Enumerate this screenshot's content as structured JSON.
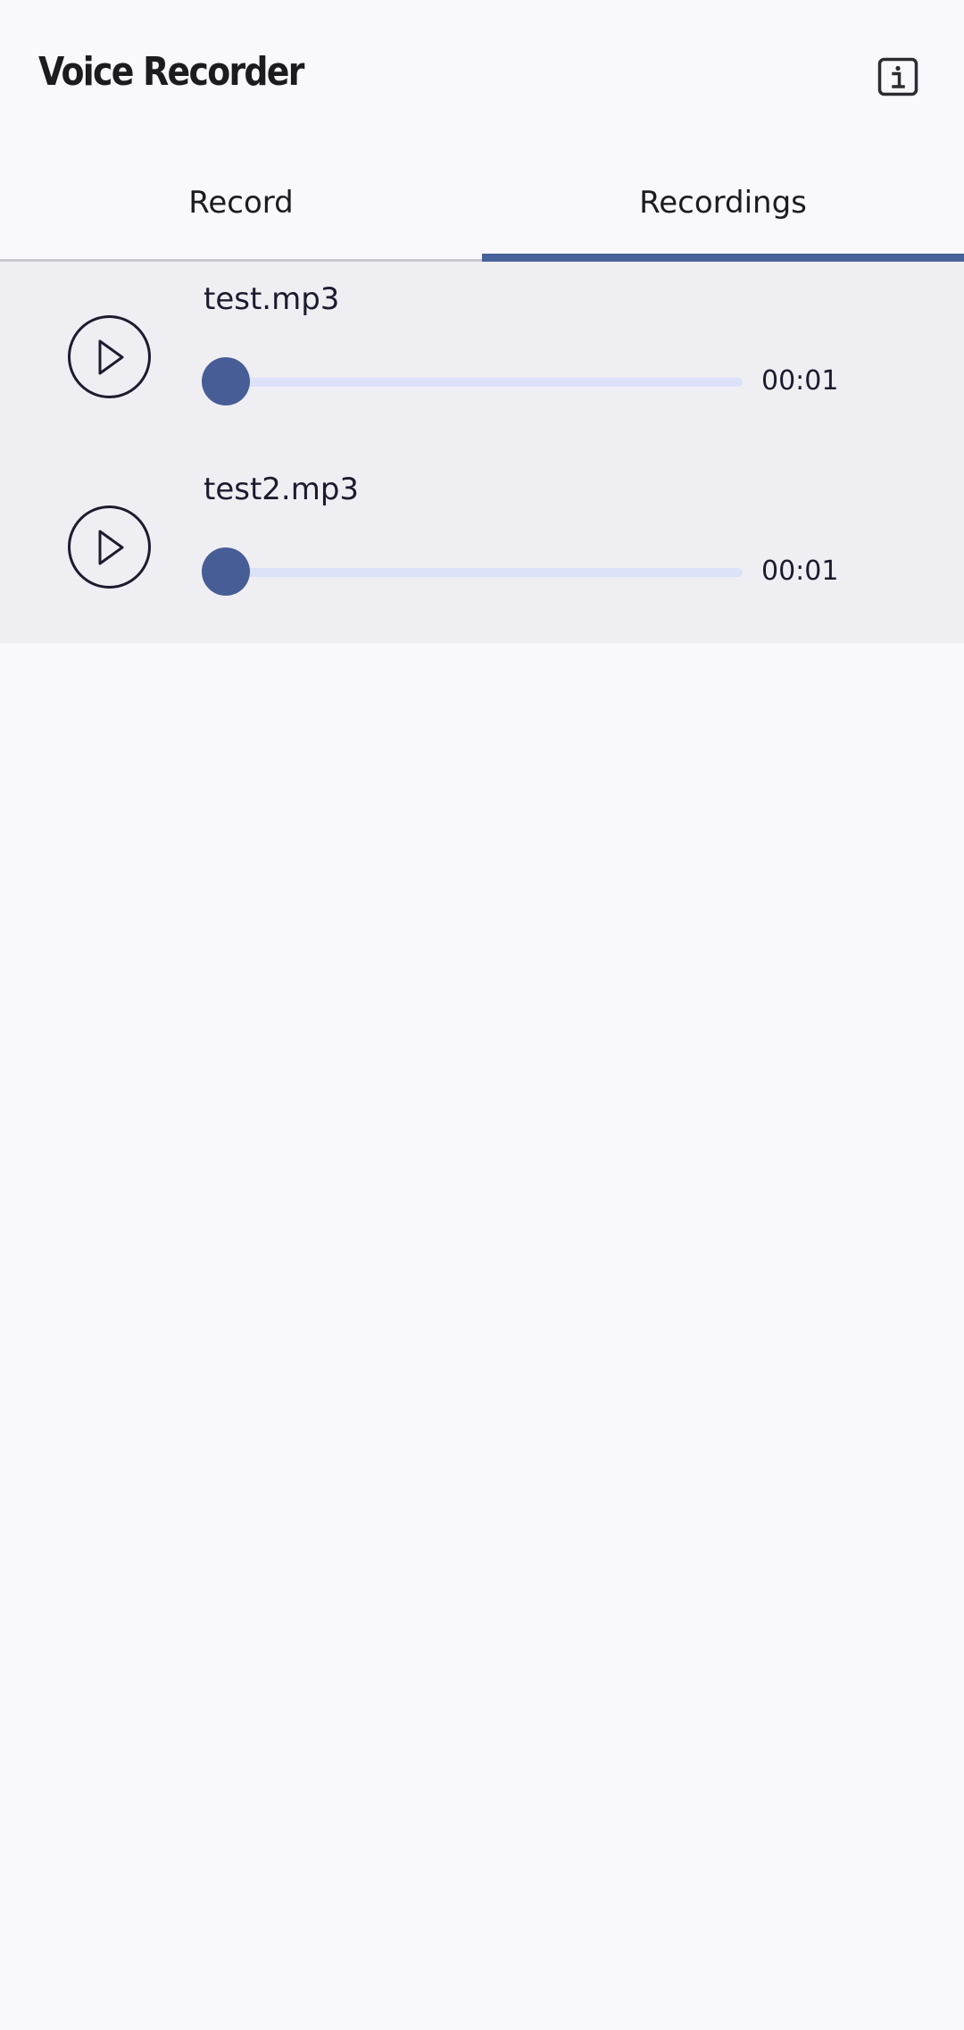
{
  "app": {
    "title": "Voice Recorder"
  },
  "header": {
    "info_icon": "info-icon"
  },
  "tabs": [
    {
      "label": "Record",
      "active": false
    },
    {
      "label": "Recordings",
      "active": true
    }
  ],
  "recordings": [
    {
      "name": "test.mp3",
      "duration": "00:01",
      "progress": 0
    },
    {
      "name": "test2.mp3",
      "duration": "00:01",
      "progress": 0
    }
  ],
  "colors": {
    "accent": "#47629a",
    "slider_track": "#dbe2f9",
    "list_background": "#efeef3",
    "page_background": "#f8f8fd"
  }
}
